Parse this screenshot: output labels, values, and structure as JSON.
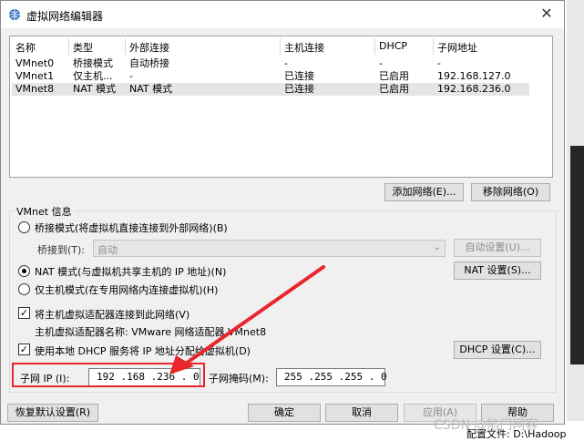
{
  "window": {
    "title": "虚拟网络编辑器",
    "close_glyph": "✕"
  },
  "table": {
    "columns": [
      "名称",
      "类型",
      "外部连接",
      "主机连接",
      "DHCP",
      "子网地址"
    ],
    "rows": [
      {
        "name": "VMnet0",
        "type": "桥接模式",
        "external": "自动桥接",
        "host": "-",
        "dhcp": "-",
        "subnet": "-"
      },
      {
        "name": "VMnet1",
        "type": "仅主机...",
        "external": "-",
        "host": "已连接",
        "dhcp": "已启用",
        "subnet": "192.168.127.0"
      },
      {
        "name": "VMnet8",
        "type": "NAT 模式",
        "external": "NAT 模式",
        "host": "已连接",
        "dhcp": "已启用",
        "subnet": "192.168.236.0"
      }
    ],
    "selected_row": 2
  },
  "list_buttons": {
    "add": "添加网络(E)...",
    "remove": "移除网络(O)"
  },
  "info": {
    "legend": "VMnet 信息",
    "bridge_radio": "桥接模式(将虚拟机直接连接到外部网络)(B)",
    "bridge_to_label": "桥接到(T):",
    "bridge_to_value": "自动",
    "auto_settings": "自动设置(U)...",
    "nat_radio": "NAT 模式(与虚拟机共享主机的 IP 地址)(N)",
    "nat_settings": "NAT 设置(S)...",
    "host_only_radio": "仅主机模式(在专用网络内连接虚拟机)(H)",
    "connect_adapter": "将主机虚拟适配器连接到此网络(V)",
    "adapter_name": "主机虚拟适配器名称: VMware 网络适配器 VMnet8",
    "use_dhcp": "使用本地 DHCP 服务将 IP 地址分配给虚拟机(D)",
    "dhcp_settings": "DHCP 设置(C)...",
    "subnet_ip_label": "子网 IP (I):",
    "subnet_ip": "192 .168 .236 . 0",
    "subnet_mask_label": "子网掩码(M):",
    "subnet_mask": "255 .255 .255 . 0",
    "selected_mode": "nat"
  },
  "footer": {
    "restore": "恢复默认设置(R)",
    "ok": "确定",
    "cancel": "取消",
    "apply": "应用(A)",
    "help": "帮助"
  },
  "background": {
    "status_text": "配置文件: D:\\Hadoop"
  },
  "watermark": "CSDN @陷门网客",
  "colors": {
    "highlight": "#e8262b",
    "selected_row": "#e5e5e5"
  }
}
